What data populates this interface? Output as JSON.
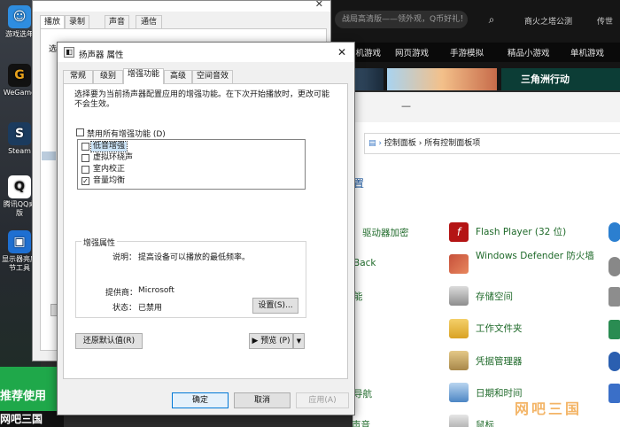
{
  "desktop": {
    "icons": [
      {
        "label": "游戏选年",
        "glyph": "☺",
        "color": "#2e8de0"
      },
      {
        "label": "WeGame",
        "glyph": "G",
        "color": "#e8a21b"
      },
      {
        "label": "Steam",
        "glyph": "S",
        "color": "#1b3b5e"
      },
      {
        "label": "腾讯QQ桌版",
        "glyph": "Q",
        "color": "#ffffff"
      },
      {
        "label": "显示器亮度节工具",
        "glyph": "▣",
        "color": "#1e6fd1"
      }
    ]
  },
  "browser": {
    "search_placeholder": "战局高清版——领外观，Q币好礼！",
    "search_icon": "search-icon",
    "top_links": [
      "商火之塔公测",
      "传世"
    ],
    "nav_items": [
      "单机游戏",
      "网页游戏",
      "手游模拟",
      "精品小游戏",
      "单机游戏"
    ],
    "banner_text": "三角洲行动"
  },
  "control_panel": {
    "breadcrumb": [
      "控制面板",
      "所有控制面板项"
    ],
    "partial_title": "置",
    "items_left": [
      "驱动器加密",
      "Back",
      "能",
      "",
      "导航",
      "声音"
    ],
    "items_right": [
      "Flash Player (32 位)",
      "Windows Defender 防火墙",
      "存储空间",
      "工作文件夹",
      "凭据管理器",
      "日期和时间",
      "鼠标"
    ],
    "watermark": "网吧三国"
  },
  "promo": {
    "line1": "推荐使用",
    "line2": "网吧三国"
  },
  "back_dialog": {
    "tabs": [
      "播放",
      "录制",
      "声音",
      "通信"
    ],
    "partial_label": "选"
  },
  "dialog": {
    "title": "扬声器 属性",
    "close_label": "✕",
    "tabs": [
      "常规",
      "级别",
      "增强功能",
      "高级",
      "空间音效"
    ],
    "active_tab": "增强功能",
    "description": "选择要为当前扬声器配置应用的增强功能。在下次开始播放时，更改可能不会生效。",
    "disable_all_label": "禁用所有增强功能 (D)",
    "effects": [
      {
        "label": "低音增强",
        "checked": false
      },
      {
        "label": "虚拟环绕声",
        "checked": false
      },
      {
        "label": "室内校正",
        "checked": false
      },
      {
        "label": "音量均衡",
        "checked": true
      }
    ],
    "properties_group": {
      "title": "增强属性",
      "description_label": "说明：",
      "description_value": "提高设备可以播放的最低频率。",
      "provider_label": "提供商：",
      "provider_value": "Microsoft",
      "status_label": "状态：",
      "status_value": "已禁用",
      "settings_button": "设置(S)..."
    },
    "restore_defaults_button": "还原默认值(R)",
    "preview_button": "▶ 预览 (P)",
    "ok_button": "确定",
    "cancel_button": "取消",
    "apply_button": "应用(A)"
  }
}
